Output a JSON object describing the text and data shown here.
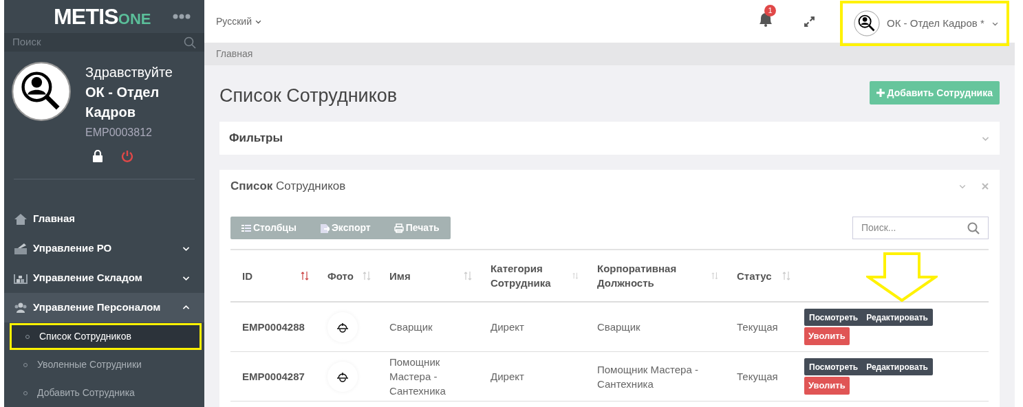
{
  "logo": {
    "main": "METIS",
    "accent": "ONE"
  },
  "sidebar": {
    "search_placeholder": "Поиск",
    "greeting": "Здравствуйте",
    "user_name": "ОК - Отдел Кадров",
    "user_id": "EMP0003812",
    "items": [
      {
        "label": "Главная",
        "kind": "link",
        "expanded": false
      },
      {
        "label": "Управление РО",
        "kind": "group",
        "expanded": false
      },
      {
        "label": "Управление Складом",
        "kind": "group",
        "expanded": false
      },
      {
        "label": "Управление Персоналом",
        "kind": "group",
        "expanded": true,
        "children": [
          {
            "label": "Список Сотрудников",
            "selected": true
          },
          {
            "label": "Уволенные Сотрудники",
            "selected": false
          },
          {
            "label": "Добавить Сотрудника",
            "selected": false
          }
        ]
      }
    ]
  },
  "topbar": {
    "language": "Русский",
    "notifications": "1",
    "user": "ОК - Отдел Кадров *"
  },
  "breadcrumb": "Главная",
  "page_title": "Список Сотрудников",
  "add_button": "Добавить Сотрудника",
  "filters": {
    "title": "Фильтры",
    "expanded": false
  },
  "list_panel": {
    "title": "**Список** Сотрудников",
    "toolbar": [
      "Столбцы",
      "Экспорт",
      "Печать"
    ],
    "search_placeholder": "Поиск...",
    "columns": [
      "ID",
      "Фото",
      "Имя",
      "Категория Сотрудника",
      "Корпоративная Должность",
      "Статус"
    ],
    "rows": [
      {
        "id": "EMP0004288",
        "name": "Сварщик",
        "category": "Директ",
        "position": "Сварщик",
        "status": "Текущая",
        "actions": [
          "Посмотреть",
          "Редактировать"
        ],
        "danger": "Уволить"
      },
      {
        "id": "EMP0004287",
        "name": "Помощник Мастера - Сантехника",
        "category": "Директ",
        "position": "Помощник Мастера - Сантехника",
        "status": "Текущая",
        "actions": [
          "Посмотреть",
          "Редактировать"
        ],
        "danger": "Уволить"
      }
    ]
  }
}
